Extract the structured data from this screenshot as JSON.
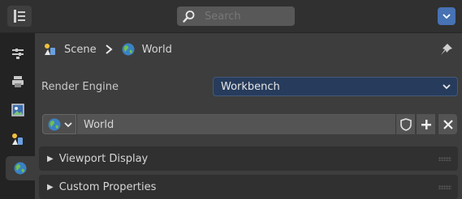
{
  "header": {
    "search_placeholder": "Search"
  },
  "tabs": [
    {
      "name": "tool-tab",
      "icon": "tool-icon"
    },
    {
      "name": "render-tab",
      "icon": "render-icon"
    },
    {
      "name": "output-tab",
      "icon": "output-icon"
    },
    {
      "name": "scene-tab",
      "icon": "scene-icon"
    },
    {
      "name": "world-tab",
      "icon": "world-icon",
      "active": true
    }
  ],
  "breadcrumb": {
    "scene_label": "Scene",
    "world_label": "World"
  },
  "render_engine": {
    "label": "Render Engine",
    "value": "Workbench"
  },
  "world_datablock": {
    "name": "World"
  },
  "panels": {
    "viewport_display": "Viewport Display",
    "custom_properties": "Custom Properties"
  },
  "colors": {
    "accent": "#4772b3",
    "select_bg": "#273c5c"
  }
}
